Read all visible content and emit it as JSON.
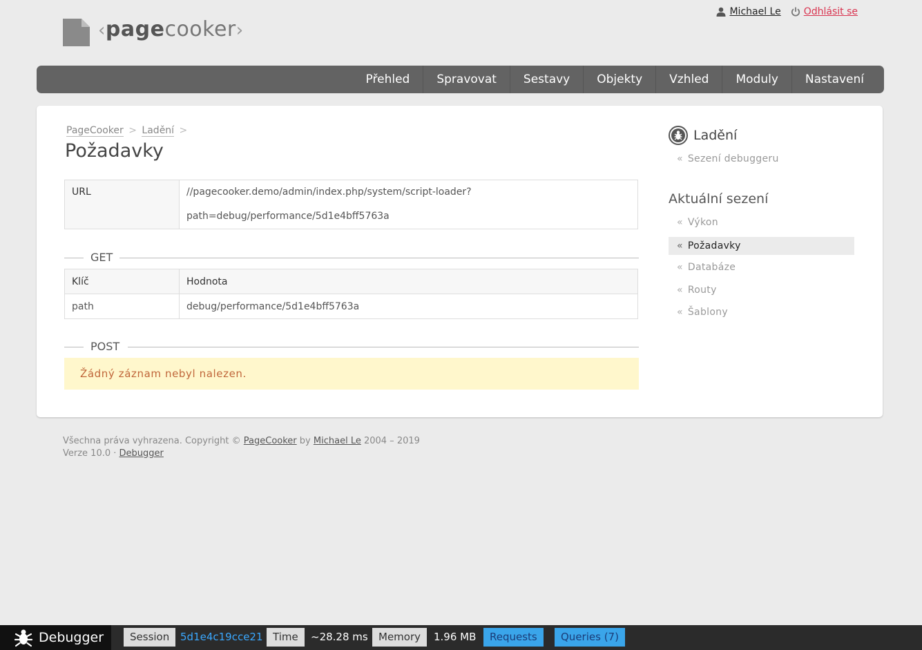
{
  "header": {
    "logo_bracket_open": "‹",
    "logo_bold": "page",
    "logo_light": "cooker",
    "logo_bracket_close": "›",
    "user_name": "Michael Le",
    "logout_label": "Odhlásit se"
  },
  "nav": {
    "items": [
      {
        "label": "Přehled"
      },
      {
        "label": "Spravovat"
      },
      {
        "label": "Sestavy"
      },
      {
        "label": "Objekty"
      },
      {
        "label": "Vzhled"
      },
      {
        "label": "Moduly"
      },
      {
        "label": "Nastavení"
      }
    ]
  },
  "breadcrumb": {
    "items": [
      "PageCooker",
      "Ladění"
    ],
    "separator": ">"
  },
  "page_title": "Požadavky",
  "url_table": {
    "key": "URL",
    "value_line1": "//pagecooker.demo/admin/index.php/system/script-loader?",
    "value_line2": "path=debug/performance/5d1e4bff5763a"
  },
  "get": {
    "section_label": "GET",
    "header_key": "Klíč",
    "header_value": "Hodnota",
    "rows": [
      {
        "key": "path",
        "value": "debug/performance/5d1e4bff5763a"
      }
    ]
  },
  "post": {
    "section_label": "POST",
    "empty_message": "Žádný záznam nebyl nalezen."
  },
  "sidebar": {
    "title": "Ladění",
    "links": [
      {
        "label": "Sezení debuggeru"
      }
    ],
    "current_heading": "Aktuální sezení",
    "current_links": [
      {
        "label": "Výkon",
        "active": false
      },
      {
        "label": "Požadavky",
        "active": true
      },
      {
        "label": "Databáze",
        "active": false
      },
      {
        "label": "Routy",
        "active": false
      },
      {
        "label": "Šablony",
        "active": false
      }
    ]
  },
  "footer": {
    "line1_prefix": "Všechna práva vyhrazena. Copyright ©",
    "line1_link1": "PageCooker",
    "line1_by": "by",
    "line1_link2": "Michael Le",
    "line1_years": "2004 – 2019",
    "line2_prefix": "Verze 10.0 ·",
    "line2_link": "Debugger"
  },
  "debugbar": {
    "brand": "Debugger",
    "session_label": "Session",
    "session_value": "5d1e4c19cce21",
    "time_label": "Time",
    "time_value": "~28.28 ms",
    "memory_label": "Memory",
    "memory_value": "1.96 MB",
    "requests_label": "Requests",
    "queries_label": "Queries (7)"
  },
  "colors": {
    "nav_bg": "#636363",
    "logout": "#d9334f",
    "notice_bg": "#fff7cc",
    "notice_text": "#c0663a",
    "debug_button": "#3aa5ea"
  }
}
